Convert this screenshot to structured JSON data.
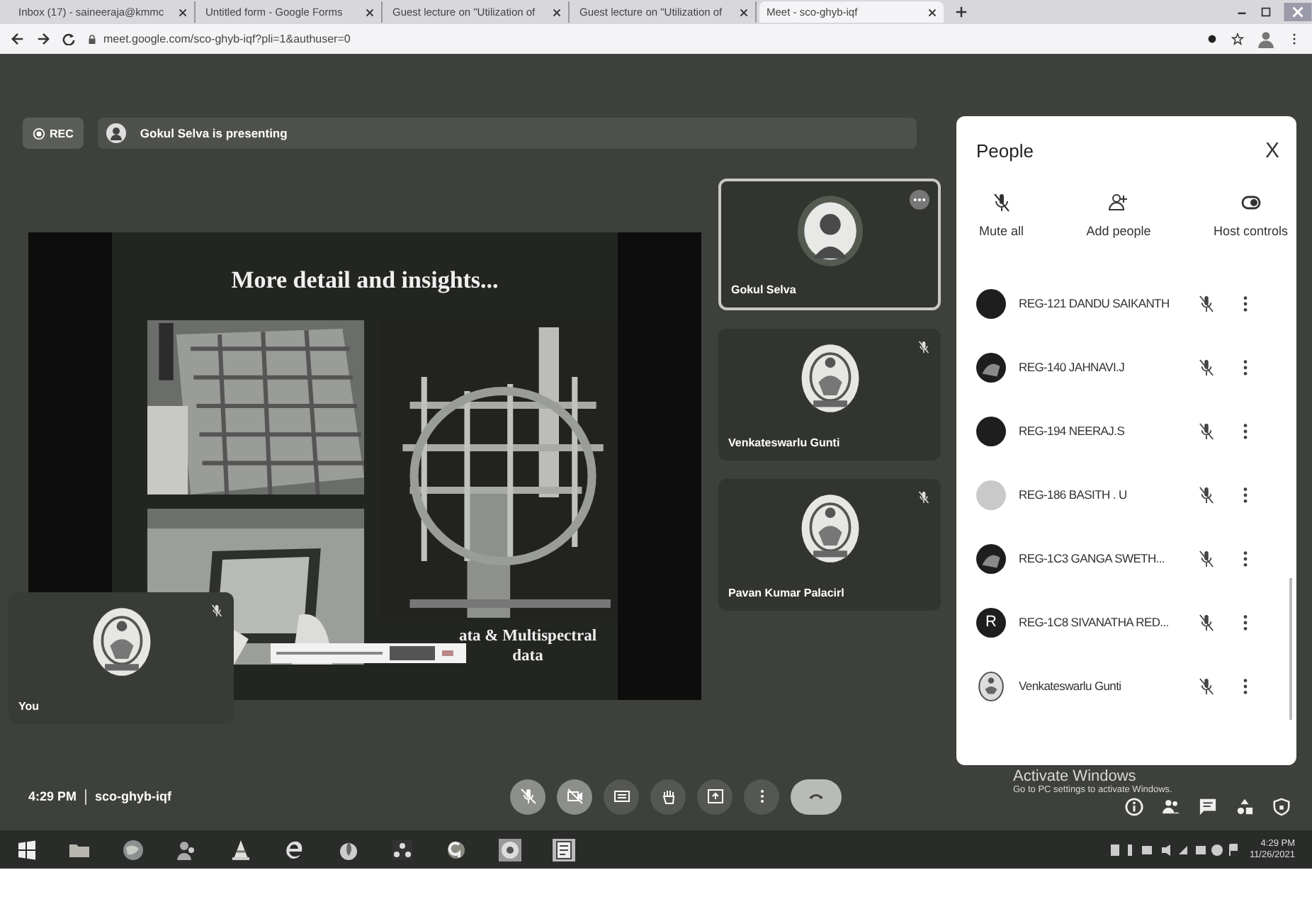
{
  "browser": {
    "tabs": [
      {
        "title": "Inbox (17) - saineeraja@kmmc",
        "selected": false
      },
      {
        "title": "Untitled form - Google Forms",
        "selected": false
      },
      {
        "title": "Guest lecture on \"Utilization of",
        "selected": false
      },
      {
        "title": "Guest lecture on \"Utilization of",
        "selected": false
      },
      {
        "title": "Meet - sco-ghyb-iqf",
        "selected": true
      }
    ],
    "url": "meet.google.com/sco-ghyb-iqf?pli=1&authuser=0"
  },
  "meet": {
    "rec": "REC",
    "presenting": "Gokul Selva is presenting",
    "slide": {
      "title": "More detail and insights...",
      "caption_1": "ata & Multispectral",
      "caption_2": "data"
    },
    "tiles": [
      {
        "name": "Gokul Selva",
        "highlighted": true,
        "muted": false
      },
      {
        "name": "Venkateswarlu Gunti",
        "kind": "emblem",
        "highlighted": false,
        "muted": true
      },
      {
        "name": "Pavan Kumar Palacirl",
        "kind": "emblem",
        "highlighted": false,
        "muted": true
      }
    ],
    "self_tile": {
      "name": "You",
      "kind": "emblem",
      "muted": true
    },
    "time": "4:29 PM",
    "code": "sco-ghyb-iqf",
    "controls": [
      {
        "kind": "mic",
        "off": true
      },
      {
        "kind": "camera",
        "off": true
      },
      {
        "kind": "captions",
        "off": false
      },
      {
        "kind": "hand",
        "off": false
      },
      {
        "kind": "present",
        "off": false
      },
      {
        "kind": "more",
        "off": false
      },
      {
        "kind": "hangup",
        "off": false
      }
    ]
  },
  "people": {
    "title": "People",
    "close": "X",
    "actions": [
      {
        "kind": "mute",
        "label": "Mute all"
      },
      {
        "kind": "add",
        "label": "Add people"
      },
      {
        "kind": "host",
        "label": "Host controls"
      }
    ],
    "list": [
      {
        "name": "REG-121 DANDU SAIKANTH",
        "kind": "dark"
      },
      {
        "name": "REG-140 JAHNAVI.J"
      },
      {
        "name": "REG-194 NEERAJ.S",
        "kind": "dark"
      },
      {
        "name": "REG-186 BASITH . U",
        "kind": "light"
      },
      {
        "name": "REG-1C3 GANGA SWETH..."
      },
      {
        "name": "REG-1C8 SIVANATHA RED...",
        "kind": "letter",
        "letter": "R"
      },
      {
        "name": "Venkateswarlu Gunti",
        "kind": "emblem"
      }
    ]
  },
  "windows_notice": {
    "title": "Activate Windows",
    "text": "Go to PC settings to activate Windows."
  },
  "taskbar": {
    "time": "4:29 PM",
    "date": "11/26/2021"
  }
}
